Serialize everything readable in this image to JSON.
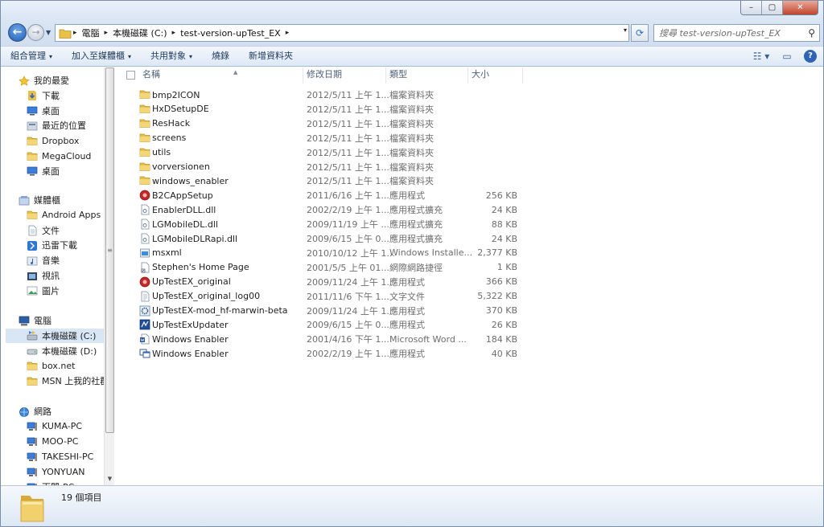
{
  "window": {
    "minimize_glyph": "–",
    "maximize_glyph": "▢",
    "close_glyph": "✕"
  },
  "address": {
    "crumbs": [
      "電腦",
      "本機磁碟 (C:)",
      "test-version-upTest_EX"
    ],
    "separator": "▸",
    "dropdown_glyph": "▾"
  },
  "search": {
    "placeholder": "搜尋 test-version-upTest_EX"
  },
  "toolbar": {
    "organize": "組合管理",
    "add_to_library": "加入至媒體櫃",
    "share_with": "共用對象",
    "burn": "燒錄",
    "new_folder": "新增資料夾",
    "dropdown_glyph": "▾"
  },
  "nav": {
    "favorites": {
      "label": "我的最愛",
      "items": [
        "下載",
        "桌面",
        "最近的位置",
        "Dropbox",
        "MegaCloud",
        "桌面"
      ]
    },
    "libraries": {
      "label": "媒體櫃",
      "items": [
        "Android Apps",
        "文件",
        "迅雷下載",
        "音樂",
        "視訊",
        "圖片"
      ]
    },
    "computer": {
      "label": "電腦",
      "items": [
        "本機磁碟 (C:)",
        "本機磁碟 (D:)",
        "box.net",
        "MSN 上我的社群"
      ]
    },
    "network": {
      "label": "網路",
      "items": [
        "KUMA-PC",
        "MOO-PC",
        "TAKESHI-PC",
        "YONYUAN",
        "下關-PC"
      ]
    }
  },
  "columns": {
    "name": "名稱",
    "date": "修改日期",
    "type": "類型",
    "size": "大小"
  },
  "files": [
    {
      "name": "bmp2ICON",
      "date": "2012/5/11 上午 1...",
      "type": "檔案資料夾",
      "size": "",
      "icon": "folder-icon"
    },
    {
      "name": "HxDSetupDE",
      "date": "2012/5/11 上午 1...",
      "type": "檔案資料夾",
      "size": "",
      "icon": "folder-icon"
    },
    {
      "name": "ResHack",
      "date": "2012/5/11 上午 1...",
      "type": "檔案資料夾",
      "size": "",
      "icon": "folder-icon"
    },
    {
      "name": "screens",
      "date": "2012/5/11 上午 1...",
      "type": "檔案資料夾",
      "size": "",
      "icon": "folder-icon"
    },
    {
      "name": "utils",
      "date": "2012/5/11 上午 1...",
      "type": "檔案資料夾",
      "size": "",
      "icon": "folder-icon"
    },
    {
      "name": "vorversionen",
      "date": "2012/5/11 上午 1...",
      "type": "檔案資料夾",
      "size": "",
      "icon": "folder-icon"
    },
    {
      "name": "windows_enabler",
      "date": "2012/5/11 上午 1...",
      "type": "檔案資料夾",
      "size": "",
      "icon": "folder-icon"
    },
    {
      "name": "B2CAppSetup",
      "date": "2011/6/16 上午 1...",
      "type": "應用程式",
      "size": "256 KB",
      "icon": "app-red-icon"
    },
    {
      "name": "EnablerDLL.dll",
      "date": "2002/2/19 上午 1...",
      "type": "應用程式擴充",
      "size": "24 KB",
      "icon": "dll-icon"
    },
    {
      "name": "LGMobileDL.dll",
      "date": "2009/11/19 上午 ...",
      "type": "應用程式擴充",
      "size": "88 KB",
      "icon": "dll-icon"
    },
    {
      "name": "LGMobileDLRapi.dll",
      "date": "2009/6/15 上午 0...",
      "type": "應用程式擴充",
      "size": "24 KB",
      "icon": "dll-icon"
    },
    {
      "name": "msxml",
      "date": "2010/10/12 上午 1...",
      "type": "Windows Installe...",
      "size": "2,377 KB",
      "icon": "installer-icon"
    },
    {
      "name": "Stephen's Home Page",
      "date": "2001/5/5 上午 01...",
      "type": "網際網路捷徑",
      "size": "1 KB",
      "icon": "shortcut-icon"
    },
    {
      "name": "UpTestEX_original",
      "date": "2009/11/24 上午 1...",
      "type": "應用程式",
      "size": "366 KB",
      "icon": "app-red-icon"
    },
    {
      "name": "UpTestEX_original_log00",
      "date": "2011/11/6 下午 1...",
      "type": "文字文件",
      "size": "5,322 KB",
      "icon": "text-file-icon"
    },
    {
      "name": "UpTestEX-mod_hf-marwin-beta",
      "date": "2009/11/24 上午 1...",
      "type": "應用程式",
      "size": "370 KB",
      "icon": "app-gear-icon"
    },
    {
      "name": "UpTestExUpdater",
      "date": "2009/6/15 上午 0...",
      "type": "應用程式",
      "size": "26 KB",
      "icon": "app-blue-icon"
    },
    {
      "name": "Windows Enabler",
      "date": "2001/4/16 下午 1...",
      "type": "Microsoft Word ...",
      "size": "184 KB",
      "icon": "word-doc-icon"
    },
    {
      "name": "Windows Enabler",
      "date": "2002/2/19 上午 1...",
      "type": "應用程式",
      "size": "40 KB",
      "icon": "app-window-icon"
    }
  ],
  "status": {
    "item_count": "19 個項目"
  },
  "colors": {
    "folder": "#e8c04a",
    "accent": "#2f63b5",
    "selection": "#d9e6f6"
  }
}
